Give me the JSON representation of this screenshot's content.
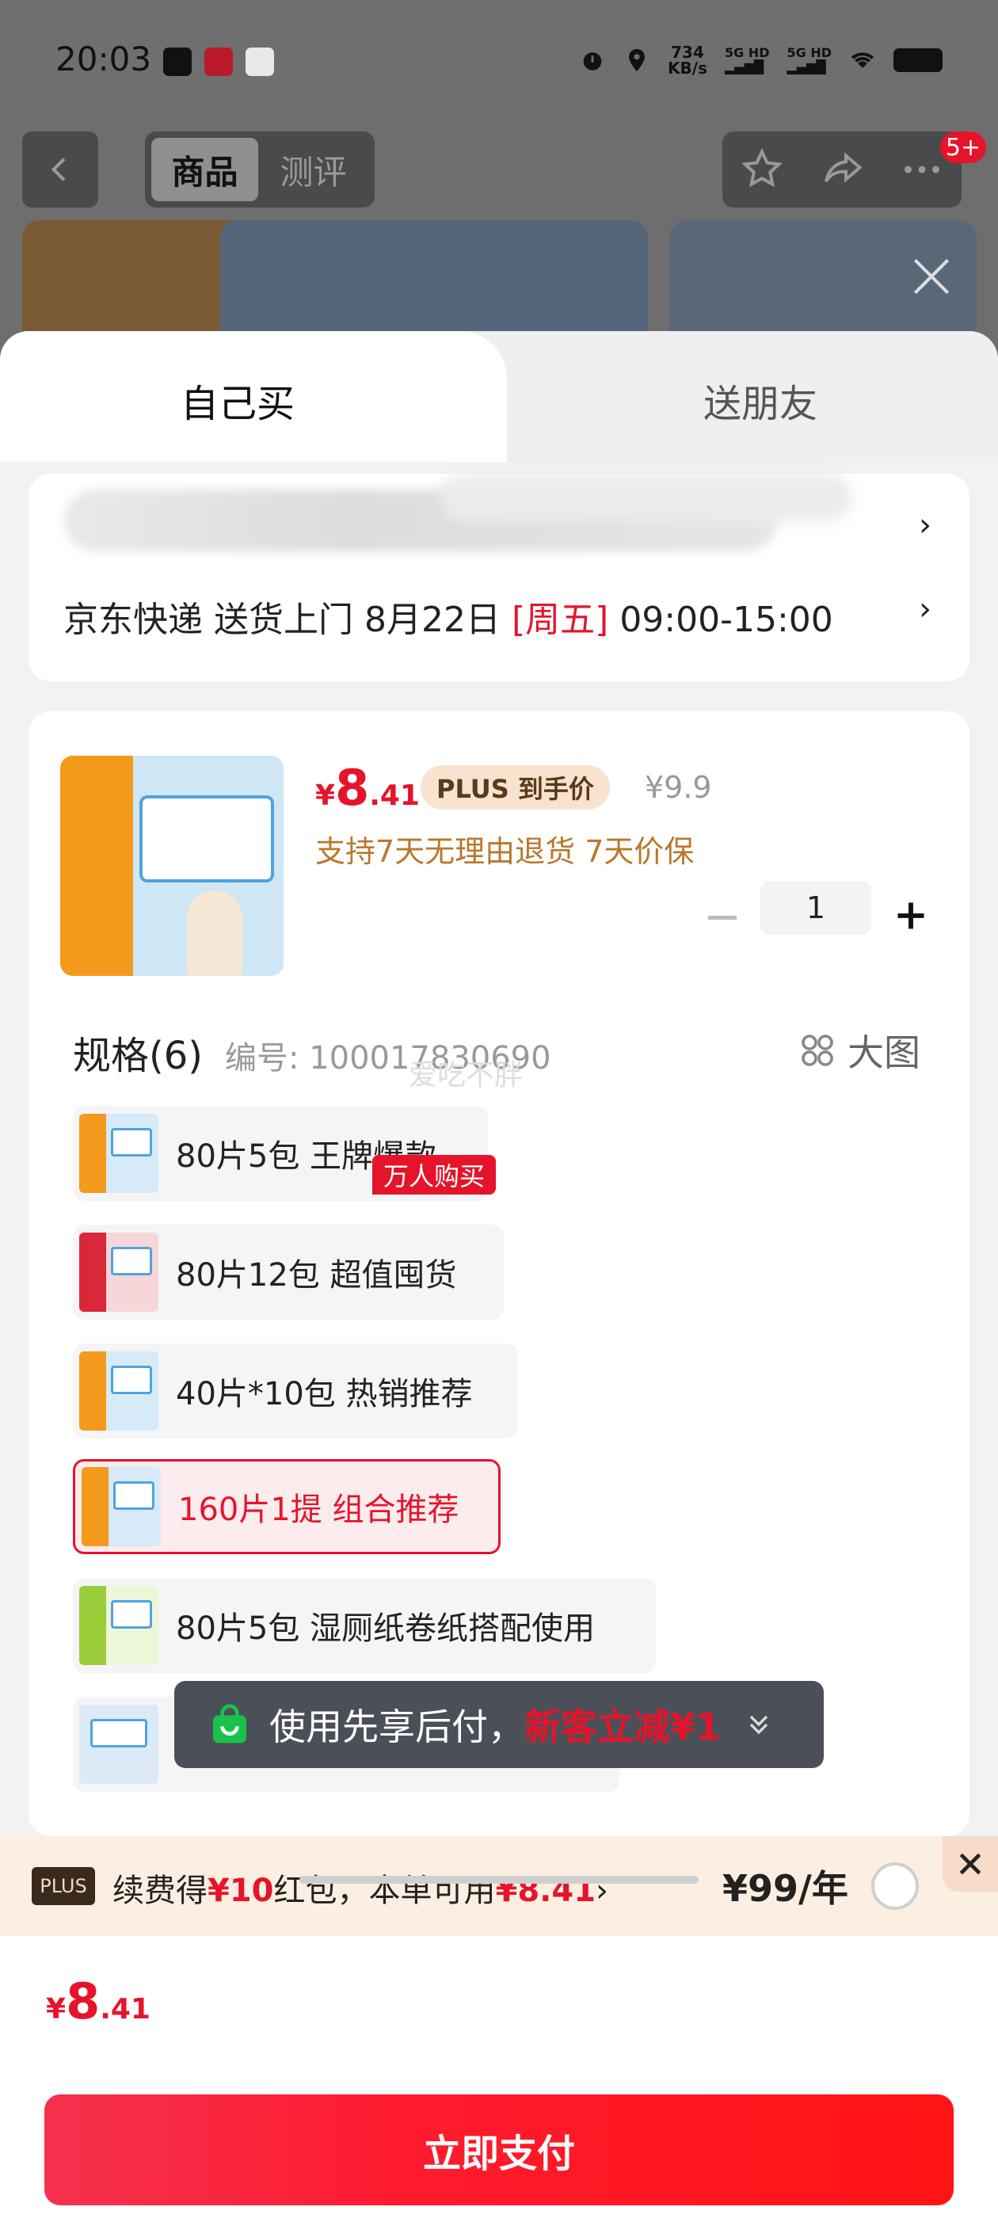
{
  "status_bar": {
    "time": "20:03",
    "net_speed_value": "734",
    "net_speed_unit": "KB/s",
    "signal_1": "5G HD",
    "signal_2": "5G HD"
  },
  "nav": {
    "tabs": [
      {
        "label": "商品"
      },
      {
        "label": "测评"
      }
    ],
    "badge": "5+"
  },
  "sheet": {
    "tabs": {
      "self": "自己买",
      "friend": "送朋友"
    },
    "delivery": {
      "text": "京东快递 送货上门 8月22日",
      "weekday": "[周五]",
      "time_range": "09:00-15:00",
      "chevron": "›"
    },
    "product": {
      "currency": "¥",
      "price_int": "8",
      "price_dec": ".41",
      "plus_tag": "PLUS 到手价",
      "original_price": "¥9.9",
      "service": "支持7天无理由退货  7天价保",
      "quantity": "1"
    },
    "spec": {
      "title": "规格(6)",
      "number": "编号: 100017830690",
      "big_image": "大图",
      "watermark": "爱吃不胖",
      "hot_badge": "万人购买",
      "items": [
        {
          "label": "80片5包 王牌爆款"
        },
        {
          "label": "80片12包 超值囤货"
        },
        {
          "label": "40片*10包 热销推荐"
        },
        {
          "label": "160片1提 组合推荐"
        },
        {
          "label": "80片5包 湿厕纸卷纸搭配使用"
        },
        {
          "label": ""
        }
      ]
    },
    "bnpl": {
      "text": "使用先享后付，",
      "highlight": "新客立减¥1"
    },
    "plus_bar": {
      "logo": "PLUS",
      "text_a": "续费得",
      "text_b": "¥10",
      "text_c": "红包，本单可用",
      "text_d": "¥8.41",
      "text_e": "›",
      "price": "¥99/年"
    },
    "total": {
      "currency": "¥",
      "price_int": "8",
      "price_dec": ".41"
    },
    "pay_button": "立即支付"
  },
  "colors": {
    "accent_red": "#e5142b",
    "plus_bg": "#fcefe1",
    "service_gold": "#b9782a"
  }
}
